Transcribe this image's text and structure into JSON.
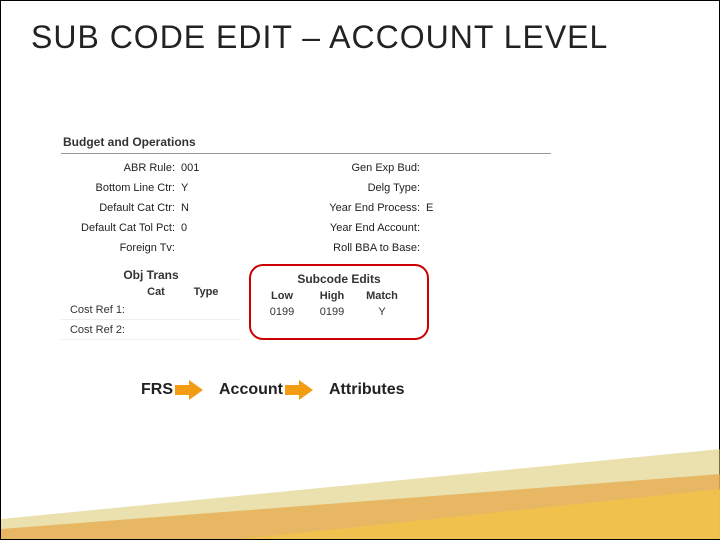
{
  "title": "SUB CODE EDIT – ACCOUNT LEVEL",
  "section_header": "Budget and Operations",
  "left_rows": [
    {
      "label": "ABR Rule:",
      "value": "001"
    },
    {
      "label": "Bottom Line Ctr:",
      "value": "Y"
    },
    {
      "label": "Default Cat Ctr:",
      "value": "N"
    },
    {
      "label": "Default Cat Tol Pct:",
      "value": "0"
    },
    {
      "label": "Foreign Tv:",
      "value": ""
    }
  ],
  "right_rows": [
    {
      "label": "Gen Exp Bud:",
      "value": ""
    },
    {
      "label": "Delg Type:",
      "value": ""
    },
    {
      "label": "Year End Process:",
      "value": "E"
    },
    {
      "label": "Year End Account:",
      "value": ""
    },
    {
      "label": "Roll BBA to Base:",
      "value": ""
    }
  ],
  "obj_trans": {
    "title": "Obj Trans",
    "headers": {
      "cat": "Cat",
      "type": "Type"
    },
    "cost_rows": [
      {
        "label": "Cost Ref 1:"
      },
      {
        "label": "Cost Ref 2:"
      }
    ]
  },
  "subcode_edits": {
    "title": "Subcode Edits",
    "headers": {
      "low": "Low",
      "high": "High",
      "match": "Match"
    },
    "row": {
      "low": "0199",
      "high": "0199",
      "match": "Y"
    }
  },
  "breadcrumb": [
    "FRS",
    "Account",
    "Attributes"
  ]
}
